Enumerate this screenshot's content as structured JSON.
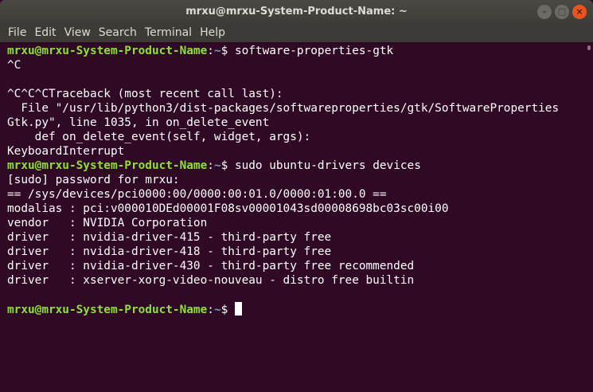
{
  "window": {
    "title": "mrxu@mrxu-System-Product-Name: ~",
    "controls": {
      "minimize": "–",
      "maximize": "□",
      "close": "×"
    }
  },
  "menubar": {
    "items": [
      "File",
      "Edit",
      "View",
      "Search",
      "Terminal",
      "Help"
    ]
  },
  "prompt": {
    "user_host": "mrxu@mrxu-System-Product-Name",
    "colon": ":",
    "path": "~",
    "dollar": "$ "
  },
  "terminal": {
    "lines": [
      {
        "type": "prompt",
        "command": "software-properties-gtk"
      },
      {
        "type": "text",
        "text": "^C"
      },
      {
        "type": "text",
        "text": ""
      },
      {
        "type": "text",
        "text": "^C^C^CTraceback (most recent call last):"
      },
      {
        "type": "text",
        "text": "  File \"/usr/lib/python3/dist-packages/softwareproperties/gtk/SoftwareProperties"
      },
      {
        "type": "text",
        "text": "Gtk.py\", line 1035, in on_delete_event"
      },
      {
        "type": "text",
        "text": "    def on_delete_event(self, widget, args):"
      },
      {
        "type": "text",
        "text": "KeyboardInterrupt"
      },
      {
        "type": "prompt",
        "command": "sudo ubuntu-drivers devices"
      },
      {
        "type": "text",
        "text": "[sudo] password for mrxu:"
      },
      {
        "type": "text",
        "text": "== /sys/devices/pci0000:00/0000:00:01.0/0000:01:00.0 =="
      },
      {
        "type": "text",
        "text": "modalias : pci:v000010DEd00001F08sv00001043sd00008698bc03sc00i00"
      },
      {
        "type": "text",
        "text": "vendor   : NVIDIA Corporation"
      },
      {
        "type": "text",
        "text": "driver   : nvidia-driver-415 - third-party free"
      },
      {
        "type": "text",
        "text": "driver   : nvidia-driver-418 - third-party free"
      },
      {
        "type": "text",
        "text": "driver   : nvidia-driver-430 - third-party free recommended"
      },
      {
        "type": "text",
        "text": "driver   : xserver-xorg-video-nouveau - distro free builtin"
      },
      {
        "type": "text",
        "text": ""
      },
      {
        "type": "prompt",
        "command": "",
        "cursor": true
      }
    ]
  },
  "colors": {
    "terminal_bg": "#300a24",
    "prompt_user": "#8ae234",
    "prompt_path": "#729fcf",
    "text": "#ffffff",
    "close_button": "#e95420"
  }
}
